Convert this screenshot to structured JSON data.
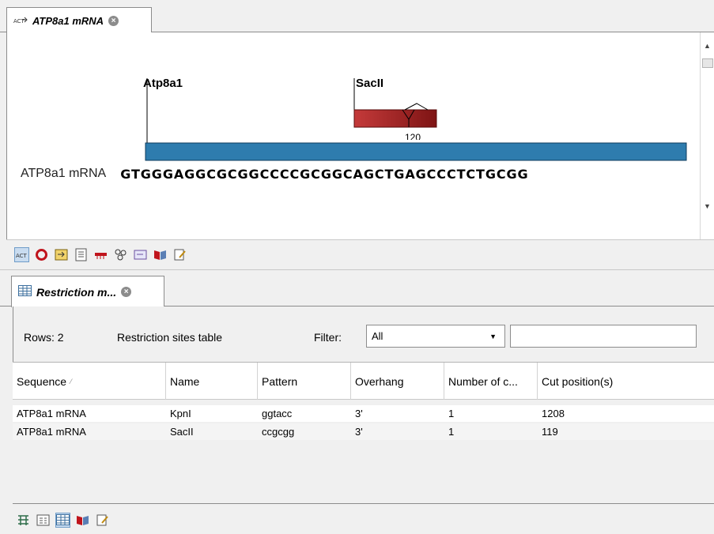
{
  "top_tab": {
    "title": "ATP8a1 mRNA",
    "icon": "sequence-tab-icon",
    "close": "×"
  },
  "sequence_view": {
    "annotations": [
      {
        "label": "Atp8a1"
      },
      {
        "label": "SacII",
        "position_label": "120",
        "color": "#9b1c1c"
      }
    ],
    "track_color": "#2e7cae",
    "sequence_name": "ATP8a1 mRNA",
    "bases": "GTGGGAGGCGCGGCCCCGCGGCAGCTGAGCCCTCTGCGG"
  },
  "top_toolbar": {
    "icons": [
      "sequence-view-icon",
      "circular-view-icon",
      "element-info-icon",
      "text-view-icon",
      "restriction-map-icon",
      "molecule-icon",
      "history-icon",
      "annotation-table-icon",
      "notes-icon"
    ]
  },
  "bottom_tab": {
    "title": "Restriction m...",
    "icon": "table-tab-icon",
    "close": "×"
  },
  "table_header_bar": {
    "rows": "Rows: 2",
    "description": "Restriction sites table",
    "filter_label": "Filter:",
    "filter_value": "All",
    "filter_text": ""
  },
  "table": {
    "columns": [
      "Sequence",
      "Name",
      "Pattern",
      "Overhang",
      "Number of c...",
      "Cut position(s)"
    ],
    "sort_indicator": "⁄",
    "rows": [
      [
        "ATP8a1 mRNA",
        "KpnI",
        "ggtacc",
        "3'",
        "1",
        "1208"
      ],
      [
        "ATP8a1 mRNA",
        "SacII",
        "ccgcgg",
        "3'",
        "1",
        "119"
      ]
    ]
  },
  "bottom_toolbar": {
    "icons": [
      "graph-view-icon",
      "form-view-icon",
      "table-view-icon",
      "book-view-icon",
      "notes-view-icon"
    ]
  }
}
